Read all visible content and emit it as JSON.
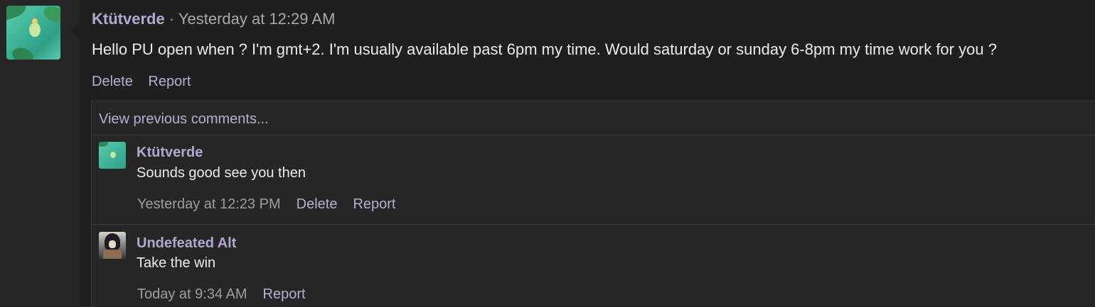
{
  "post": {
    "author": "Ktütverde",
    "separator": " · ",
    "timestamp": "Yesterday at 12:29 AM",
    "message": "Hello PU open when ? I'm gmt+2. I'm usually available past 6pm my time. Would saturday or sunday 6-8pm my time work for you ?",
    "actions": {
      "delete": "Delete",
      "report": "Report"
    }
  },
  "comments_section": {
    "view_previous": "View previous comments...",
    "comments": [
      {
        "author": "Ktütverde",
        "text": "Sounds good see you then",
        "timestamp": "Yesterday at 12:23 PM",
        "delete": "Delete",
        "report": "Report"
      },
      {
        "author": "Undefeated Alt",
        "text": "Take the win",
        "timestamp": "Today at 9:34 AM",
        "report": "Report"
      }
    ]
  },
  "colors": {
    "author_name": "#b3a7d0",
    "link": "#b7afd1",
    "background": "#1f1f1f"
  }
}
